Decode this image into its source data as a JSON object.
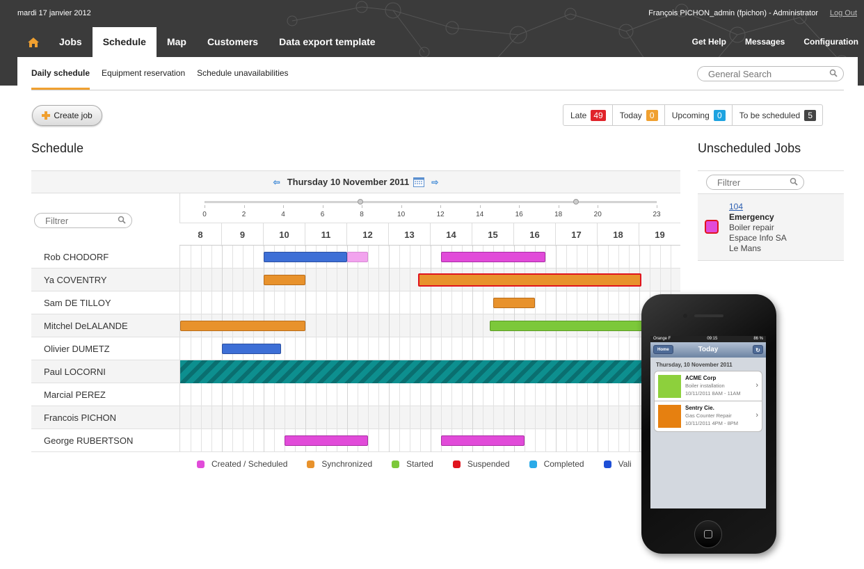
{
  "header": {
    "date": "mardi 17 janvier 2012",
    "user": "François PICHON_admin (fpichon) - Administrator",
    "logout": "Log Out"
  },
  "nav": {
    "tabs": [
      "Jobs",
      "Schedule",
      "Map",
      "Customers",
      "Data export template"
    ],
    "active": "Schedule",
    "right": [
      "Get Help",
      "Messages",
      "Configuration"
    ]
  },
  "subnav": {
    "tabs": [
      "Daily schedule",
      "Equipment reservation",
      "Schedule unavailabilities"
    ],
    "search_placeholder": "General Search"
  },
  "actions": {
    "create_job": "Create job"
  },
  "counters": [
    {
      "label": "Late",
      "count": "49",
      "color": "#e0232a"
    },
    {
      "label": "Today",
      "count": "0",
      "color": "#f0a030"
    },
    {
      "label": "Upcoming",
      "count": "0",
      "color": "#1ea3e0"
    },
    {
      "label": "To be scheduled",
      "count": "5",
      "color": "#444444"
    }
  ],
  "schedule": {
    "title": "Schedule",
    "date": "Thursday 10 November 2011",
    "filter_placeholder": "Filtrer",
    "slider_ticks": [
      "0",
      "2",
      "4",
      "6",
      "8",
      "10",
      "12",
      "14",
      "16",
      "18",
      "20",
      "23"
    ],
    "hours": [
      "8",
      "9",
      "10",
      "11",
      "12",
      "13",
      "14",
      "15",
      "16",
      "17",
      "18",
      "19"
    ],
    "rows": [
      {
        "name": "Rob CHODORF",
        "bars": [
          {
            "start": 10,
            "end": 12,
            "status": "blue"
          },
          {
            "start": 12,
            "end": 12.5,
            "status": "pinklight"
          },
          {
            "start": 14.25,
            "end": 16.75,
            "status": "pink"
          }
        ]
      },
      {
        "name": "Ya COVENTRY",
        "bars": [
          {
            "start": 10,
            "end": 11,
            "status": "orange"
          },
          {
            "start": 13.7,
            "end": 19.05,
            "status": "orange sel"
          }
        ]
      },
      {
        "name": "Sam DE TILLOY",
        "bars": [
          {
            "start": 15.5,
            "end": 16.5,
            "status": "orange"
          }
        ]
      },
      {
        "name": "Mitchel DeLALANDE",
        "bars": [
          {
            "start": 8,
            "end": 11,
            "status": "orange"
          },
          {
            "start": 15.42,
            "end": 19.2,
            "status": "green"
          }
        ]
      },
      {
        "name": "Olivier DUMETZ",
        "bars": [
          {
            "start": 9,
            "end": 10.42,
            "status": "blue"
          }
        ]
      },
      {
        "name": "Paul LOCORNI",
        "bars": [
          {
            "start": 8,
            "end": 20,
            "status": "teal"
          }
        ]
      },
      {
        "name": "Marcial PEREZ",
        "bars": []
      },
      {
        "name": "Francois PICHON",
        "bars": []
      },
      {
        "name": "George RUBERTSON",
        "bars": [
          {
            "start": 10.5,
            "end": 12.5,
            "status": "pink"
          },
          {
            "start": 14.25,
            "end": 16.25,
            "status": "pink"
          }
        ]
      }
    ]
  },
  "legend": [
    {
      "label": "Created / Scheduled",
      "color": "#e14bd9"
    },
    {
      "label": "Synchronized",
      "color": "#e8922c"
    },
    {
      "label": "Started",
      "color": "#7cc83a"
    },
    {
      "label": "Suspended",
      "color": "#e0141e"
    },
    {
      "label": "Completed",
      "color": "#2aaae8"
    },
    {
      "label": "Vali",
      "color": "#1e4fd6"
    }
  ],
  "unscheduled": {
    "title": "Unscheduled Jobs",
    "filter_placeholder": "Filtrer",
    "job": {
      "id": "104",
      "type": "Emergency",
      "desc": "Boiler repair",
      "company": "Espace Info SA",
      "city": "Le Mans"
    }
  },
  "phone": {
    "carrier": "Orange F",
    "time": "09:15",
    "battery": "86 %",
    "home": "Home",
    "title": "Today",
    "day": "Thursday, 10 November 2011",
    "items": [
      {
        "company": "ACME Corp",
        "job": "Boiler installation",
        "time": "10/11/2011 8AM - 11AM",
        "color": "#8dd03c"
      },
      {
        "company": "Sentry Cie.",
        "job": "Gas Counter Repair",
        "time": "10/11/2011 4PM - 8PM",
        "color": "#e68010"
      }
    ]
  }
}
